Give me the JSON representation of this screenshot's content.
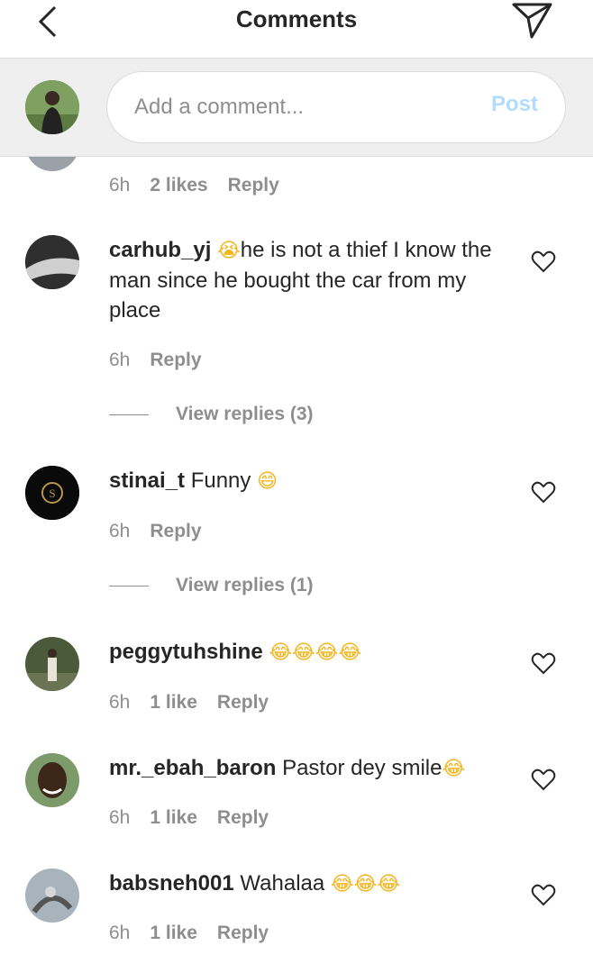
{
  "header": {
    "title": "Comments",
    "back_icon": "chevron-left-icon",
    "send_icon": "paper-plane-icon"
  },
  "composer": {
    "placeholder": "Add a comment...",
    "post_label": "Post"
  },
  "partial_comment": {
    "time": "6h",
    "likes": "2 likes",
    "reply": "Reply"
  },
  "comments": [
    {
      "user": "carhub_yj",
      "emoji_before": "😭",
      "text": "he is not a thief I know the man since he bought the car from my place",
      "time": "6h",
      "likes": "",
      "reply": "Reply",
      "view_replies": "View replies (3)"
    },
    {
      "user": "stinai_t",
      "text": "Funny ",
      "emoji_after": "😄",
      "time": "6h",
      "likes": "",
      "reply": "Reply",
      "view_replies": "View replies (1)"
    },
    {
      "user": "peggytuhshine",
      "text": " ",
      "emoji_after": "😂😂😂😂",
      "time": "6h",
      "likes": "1 like",
      "reply": "Reply"
    },
    {
      "user": "mr._ebah_baron",
      "text": "Pastor dey smile",
      "emoji_after": "😂",
      "time": "6h",
      "likes": "1 like",
      "reply": "Reply"
    },
    {
      "user": "babsneh001",
      "text": "Wahalaa ",
      "emoji_after": "😂😂😂",
      "time": "6h",
      "likes": "1 like",
      "reply": "Reply"
    }
  ],
  "colors": {
    "accent_post_disabled": "#b3dbff",
    "text": "#262626",
    "muted": "#8e8e8e",
    "composer_bg": "#efefef"
  }
}
